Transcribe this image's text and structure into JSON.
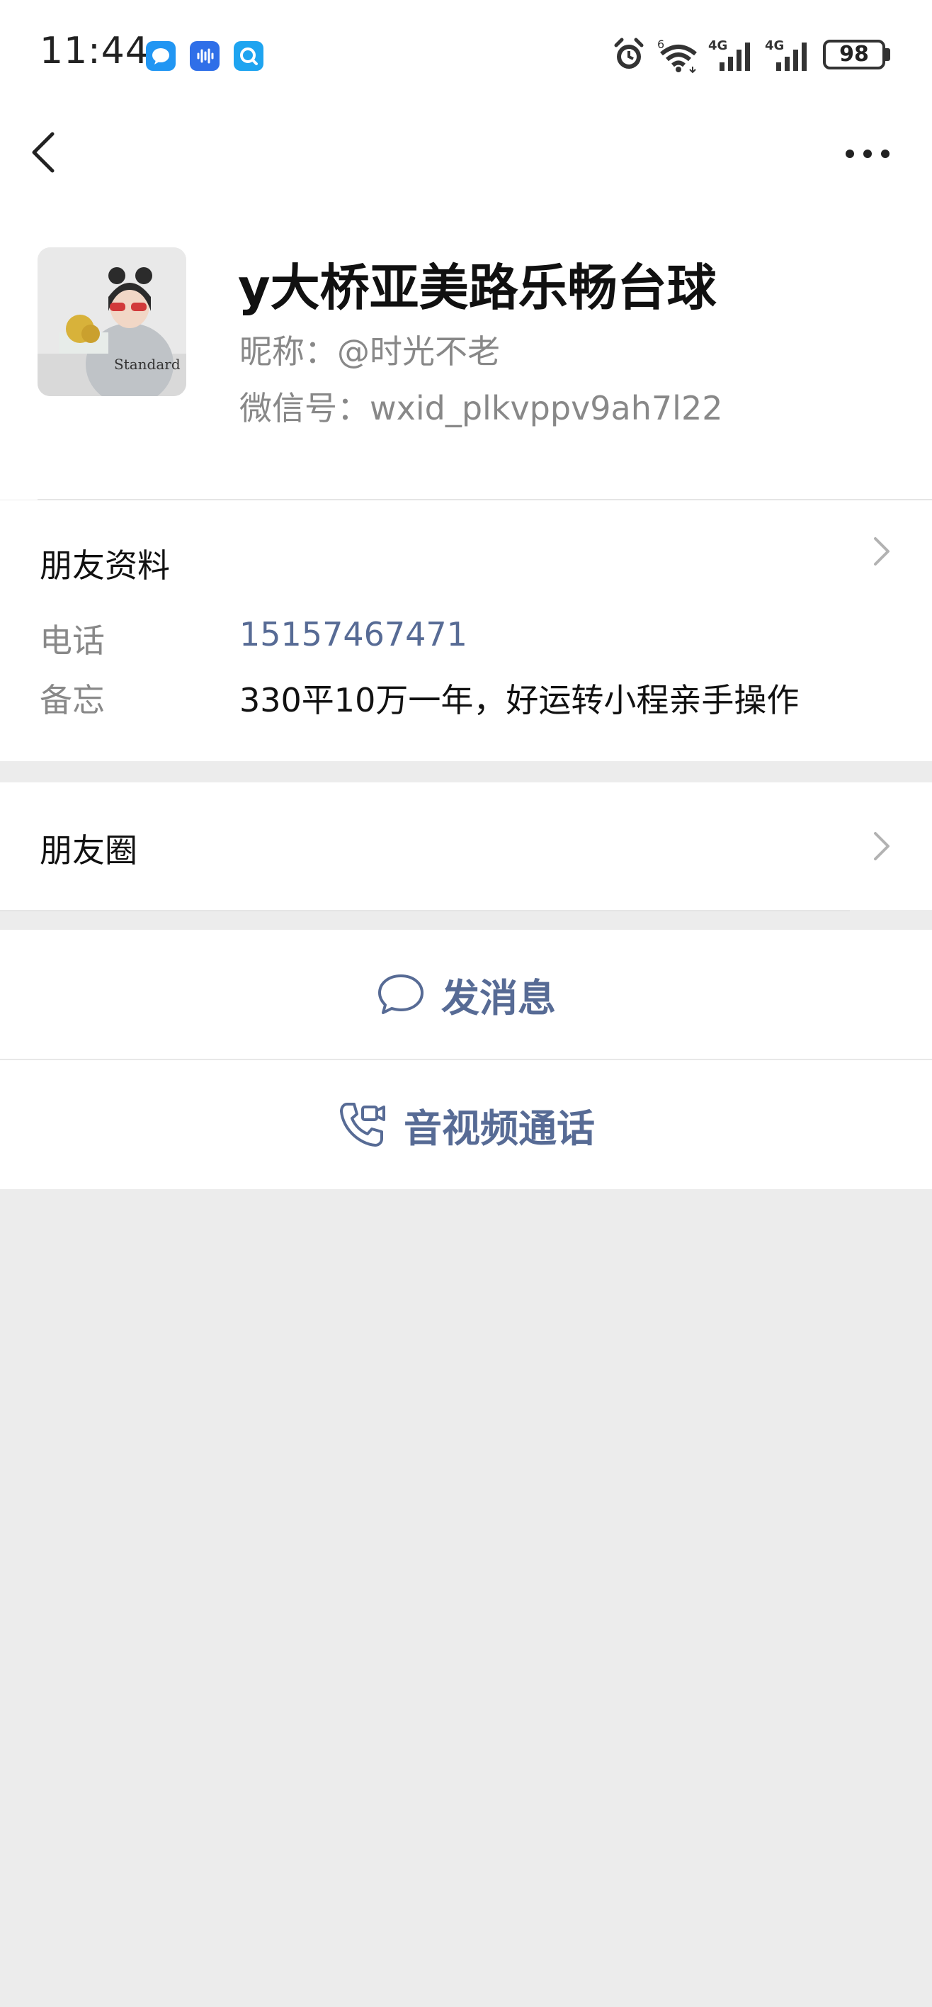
{
  "status_bar": {
    "time": "11:44",
    "battery": "98",
    "notification_icons": [
      "message-bubble-icon",
      "voice-wave-icon",
      "search-app-icon"
    ],
    "right_icons": [
      "alarm-icon",
      "wifi-icon",
      "signal-4g-icon",
      "signal-4g-icon",
      "battery-icon"
    ]
  },
  "nav": {
    "back_icon": "chevron-left-icon",
    "more_icon": "ellipsis-icon"
  },
  "profile": {
    "display_name": "y大桥亚美路乐畅台球",
    "nickname": "昵称：@时光不老",
    "wechat_id": "微信号：wxid_plkvppv9ah7l22"
  },
  "friend_info": {
    "title": "朋友资料",
    "phone_label": "电话",
    "phone_value": "15157467471",
    "memo_label": "备忘",
    "memo_value": "330平10万一年，好运转小程亲手操作"
  },
  "moments": {
    "title": "朋友圈"
  },
  "actions": {
    "message_label": "发消息",
    "call_label": "音视频通话"
  },
  "colors": {
    "link_blue": "#576b95",
    "background_gray": "#ececec",
    "secondary_text": "#888888"
  }
}
